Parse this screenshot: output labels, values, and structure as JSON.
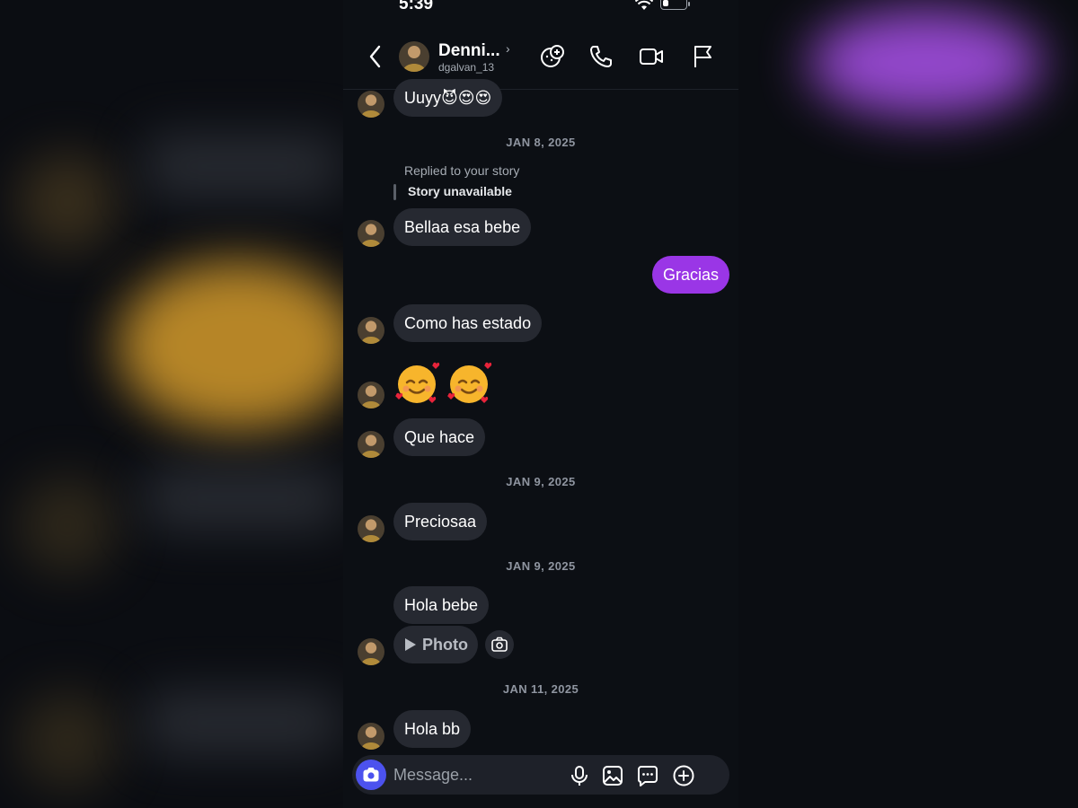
{
  "status_bar": {
    "time": "5:39"
  },
  "header": {
    "display_name": "Denni...",
    "username": "dgalvan_13",
    "icons": [
      "back-chevron-icon",
      "sticker-icon",
      "phone-icon",
      "video-icon",
      "flag-icon"
    ]
  },
  "messages": {
    "m1": "Uuyy😈😍😍",
    "date1": "JAN 8, 2025",
    "reply_label": "Replied to your story",
    "reply_story": "Story unavailable",
    "m2": "Bellaa esa bebe",
    "m3_outgoing": "Gracias",
    "m4": "Como has estado",
    "m5_emojis": "🥰🥰",
    "m6": "Que hace",
    "date2": "JAN 9, 2025",
    "m7": "Preciosaa",
    "date3": "JAN 9, 2025",
    "m8": "Hola bebe",
    "photo_label": "Photo",
    "date4": "JAN 11, 2025",
    "m9": "Hola bb"
  },
  "composer": {
    "placeholder": "Message...",
    "icons": [
      "camera-icon",
      "microphone-icon",
      "gallery-icon",
      "sticker-chat-icon",
      "plus-icon"
    ]
  },
  "colors": {
    "background": "#0c0f14",
    "incoming_bubble": "#262931",
    "outgoing_bubble": "#9a36e6",
    "camera_button": "#4c52ee"
  }
}
